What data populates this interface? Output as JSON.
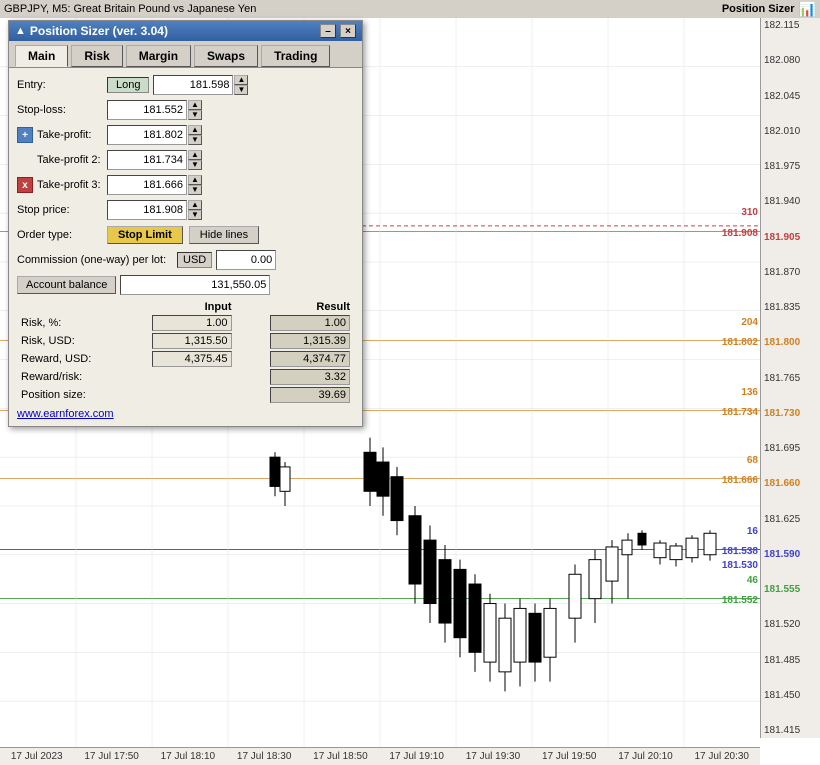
{
  "chart": {
    "title": "GBPJPY, M5: Great Britain Pound vs Japanese Yen",
    "position_sizer_label": "Position Sizer",
    "prices": [
      "182.115",
      "182.080",
      "182.045",
      "182.010",
      "181.975",
      "181.940",
      "181.905",
      "181.870",
      "181.835",
      "181.800",
      "181.765",
      "181.730",
      "181.695",
      "181.660",
      "181.625",
      "181.590",
      "181.555",
      "181.520",
      "181.485",
      "181.450",
      "181.415"
    ],
    "times": [
      "17 Jul 2023",
      "17 Jul 17:50",
      "17 Jul 18:10",
      "17 Jul 18:30",
      "17 Jul 18:50",
      "17 Jul 19:10",
      "17 Jul 19:30",
      "17 Jul 19:50",
      "17 Jul 20:10",
      "17 Jul 20:30"
    ]
  },
  "panel": {
    "title": "Position Sizer (ver. 3.04)",
    "minimize_label": "–",
    "close_label": "×",
    "tabs": {
      "main": "Main",
      "risk": "Risk",
      "margin": "Margin",
      "swaps": "Swaps",
      "trading": "Trading"
    },
    "entry_label": "Entry:",
    "entry_type": "Long",
    "entry_value": "181.598",
    "stoploss_label": "Stop-loss:",
    "stoploss_value": "181.552",
    "takeprofit_label": "Take-profit:",
    "takeprofit_value": "181.802",
    "takeprofit2_label": "Take-profit 2:",
    "takeprofit2_value": "181.734",
    "takeprofit3_label": "Take-profit 3:",
    "takeprofit3_value": "181.666",
    "stopprice_label": "Stop price:",
    "stopprice_value": "181.908",
    "ordertype_label": "Order type:",
    "ordertype_btn": "Stop Limit",
    "hidelines_btn": "Hide lines",
    "commission_label": "Commission (one-way) per lot:",
    "commission_currency": "USD",
    "commission_value": "0.00",
    "account_balance_btn": "Account balance",
    "account_balance_value": "131,550.05",
    "col_input": "Input",
    "col_result": "Result",
    "risk_pct_label": "Risk, %:",
    "risk_pct_input": "1.00",
    "risk_pct_result": "1.00",
    "risk_usd_label": "Risk, USD:",
    "risk_usd_input": "1,315.50",
    "risk_usd_result": "1,315.39",
    "reward_usd_label": "Reward, USD:",
    "reward_usd_input": "4,375.45",
    "reward_usd_result": "4,374.77",
    "reward_risk_label": "Reward/risk:",
    "reward_risk_result": "3.32",
    "position_size_label": "Position size:",
    "position_size_result": "39.69",
    "earnforex_link": "www.earnforex.com"
  },
  "lines": {
    "stop_price": {
      "value": "181.908",
      "label": "310",
      "color": "#d04040"
    },
    "tp": {
      "value": "181.802",
      "label": "204",
      "color": "#d08020"
    },
    "tp2": {
      "value": "181.734",
      "label": "136",
      "color": "#d08020"
    },
    "tp3": {
      "value": "181.666",
      "label": "68",
      "color": "#d08020"
    },
    "entry": {
      "value": "181.598",
      "label": "16",
      "color": "#4040d0"
    },
    "sl": {
      "value": "181.552",
      "label": "46",
      "color": "#40a040"
    }
  }
}
